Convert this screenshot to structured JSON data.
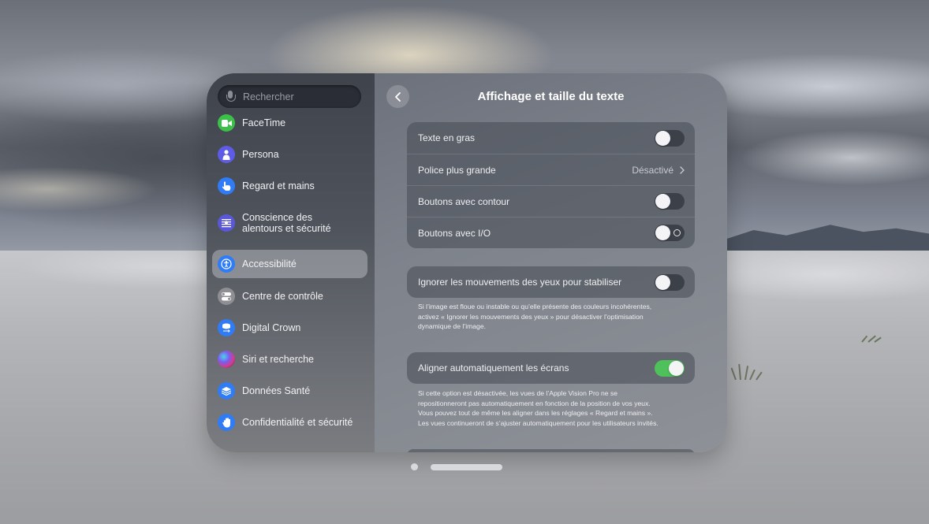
{
  "sidebar": {
    "search_placeholder": "Rechercher",
    "items": [
      {
        "label": "FaceTime",
        "icon": "facetime-icon",
        "color": "#3cc04a"
      },
      {
        "label": "Persona",
        "icon": "persona-icon",
        "color": "#5e5ce6"
      },
      {
        "label": "Regard et mains",
        "icon": "hand-pointer-icon",
        "color": "#2f7cf6"
      },
      {
        "label": "Conscience des\nalentours et sécurité",
        "label_line1": "Conscience des",
        "label_line2": "alentours et sécurité",
        "icon": "surroundings-icon",
        "color": "#5a58d8"
      },
      {
        "label": "Accessibilité",
        "icon": "accessibility-icon",
        "color": "#2f7cf6",
        "active": true
      },
      {
        "label": "Centre de contrôle",
        "icon": "control-center-icon",
        "color": "#8e8e93"
      },
      {
        "label": "Digital Crown",
        "icon": "digital-crown-icon",
        "color": "#2f7cf6"
      },
      {
        "label": "Siri et recherche",
        "icon": "siri-icon",
        "color": "#b04a8f"
      },
      {
        "label": "Données Santé",
        "icon": "health-data-icon",
        "color": "#2f7cf6"
      },
      {
        "label": "Confidentialité et sécurité",
        "icon": "privacy-hand-icon",
        "color": "#2f7cf6"
      }
    ]
  },
  "main": {
    "title": "Affichage et taille du texte",
    "group1": [
      {
        "label": "Texte en gras",
        "type": "toggle",
        "on": false
      },
      {
        "label": "Police plus grande",
        "type": "link",
        "value": "Désactivé"
      },
      {
        "label": "Boutons avec contour",
        "type": "toggle",
        "on": false
      },
      {
        "label": "Boutons avec I/O",
        "type": "toggle",
        "on": false
      }
    ],
    "group2": {
      "label": "Ignorer les mouvements des yeux pour stabiliser",
      "on": false,
      "footnote_line1": "Si l’image est floue ou instable ou qu’elle présente des couleurs incohérentes,",
      "footnote_line2": "activez « Ignorer les mouvements des yeux » pour désactiver l’optimisation",
      "footnote_line3": "dynamique de l’image."
    },
    "group3": {
      "label": "Aligner automatiquement les écrans",
      "on": true,
      "footnote_line1": "Si cette option est désactivée, les vues de l’Apple Vision Pro ne se",
      "footnote_line2": "repositionneront pas automatiquement en fonction de la position de vos yeux.",
      "footnote_line3": "Vous pouvez tout de même les aligner dans les réglages « Regard et mains ».",
      "footnote_line4": "Les vues continueront de s’ajuster automatiquement pour les utilisateurs invités."
    }
  },
  "colors": {
    "toggle_on": "#4fc15a",
    "toggle_off": "#3c4049"
  }
}
